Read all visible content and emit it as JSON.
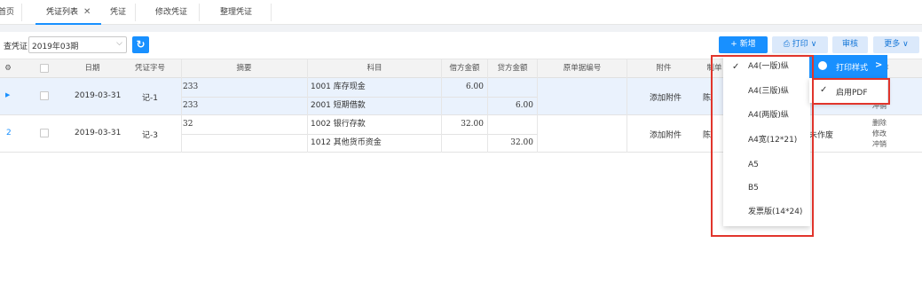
{
  "tabs": [
    {
      "label": "首页"
    },
    {
      "label": "凭证列表",
      "close": "✕"
    },
    {
      "label": "凭证"
    },
    {
      "label": "修改凭证"
    },
    {
      "label": "整理凭证"
    }
  ],
  "toolbar": {
    "query_label": "查凭证",
    "period_value": "2019年03期",
    "add_label": "+ 新增",
    "print_label": "打印",
    "audit_label": "审核",
    "more_label": "更多"
  },
  "table": {
    "headers": {
      "settings": "⚙",
      "date": "日期",
      "voucher_no": "凭证字号",
      "summary": "摘要",
      "subject": "科目",
      "debit": "借方金额",
      "credit": "贷方金额",
      "doc_no": "原单据编号",
      "attachment": "附件",
      "maker": "制单",
      "status": "",
      "ops": "操作"
    },
    "rows": [
      {
        "indicator": "▶",
        "date": "2019-03-31",
        "voucher_no": "记-1",
        "lines": [
          {
            "summary": "233",
            "subject": "1001 库存现金",
            "debit": "6.00",
            "credit": ""
          },
          {
            "summary": "233",
            "subject": "2001 短期借款",
            "debit": "",
            "credit": "6.00"
          }
        ],
        "attachment": "添加附件",
        "maker": "陈",
        "ops": [
          "删",
          "修",
          "冲销"
        ]
      },
      {
        "indicator": "2",
        "date": "2019-03-31",
        "voucher_no": "记-3",
        "lines": [
          {
            "summary": "32",
            "subject": "1002 银行存款",
            "debit": "32.00",
            "credit": ""
          },
          {
            "summary": "",
            "subject": "1012 其他货币资金",
            "debit": "",
            "credit": "32.00"
          }
        ],
        "attachment": "添加附件",
        "maker": "陈",
        "status": "未作废",
        "ops": [
          "删除",
          "修改",
          "冲销"
        ]
      }
    ]
  },
  "print_menu": {
    "items": [
      {
        "label": "A4(一版)纵",
        "checked": true
      },
      {
        "label": "A4(三版)纵",
        "checked": false
      },
      {
        "label": "A4(两版)纵",
        "checked": false
      },
      {
        "label": "A4宽(12*21)",
        "checked": false
      },
      {
        "label": "A5",
        "checked": false
      },
      {
        "label": "B5",
        "checked": false
      },
      {
        "label": "发票版(14*24)",
        "checked": false
      }
    ],
    "submenu_title": "打印样式",
    "submenu_arrow": ">",
    "pdf_label": "启用PDF",
    "pdf_checked": "✓"
  },
  "colors": {
    "accent": "#1890ff",
    "highlight": "#e1352c"
  }
}
